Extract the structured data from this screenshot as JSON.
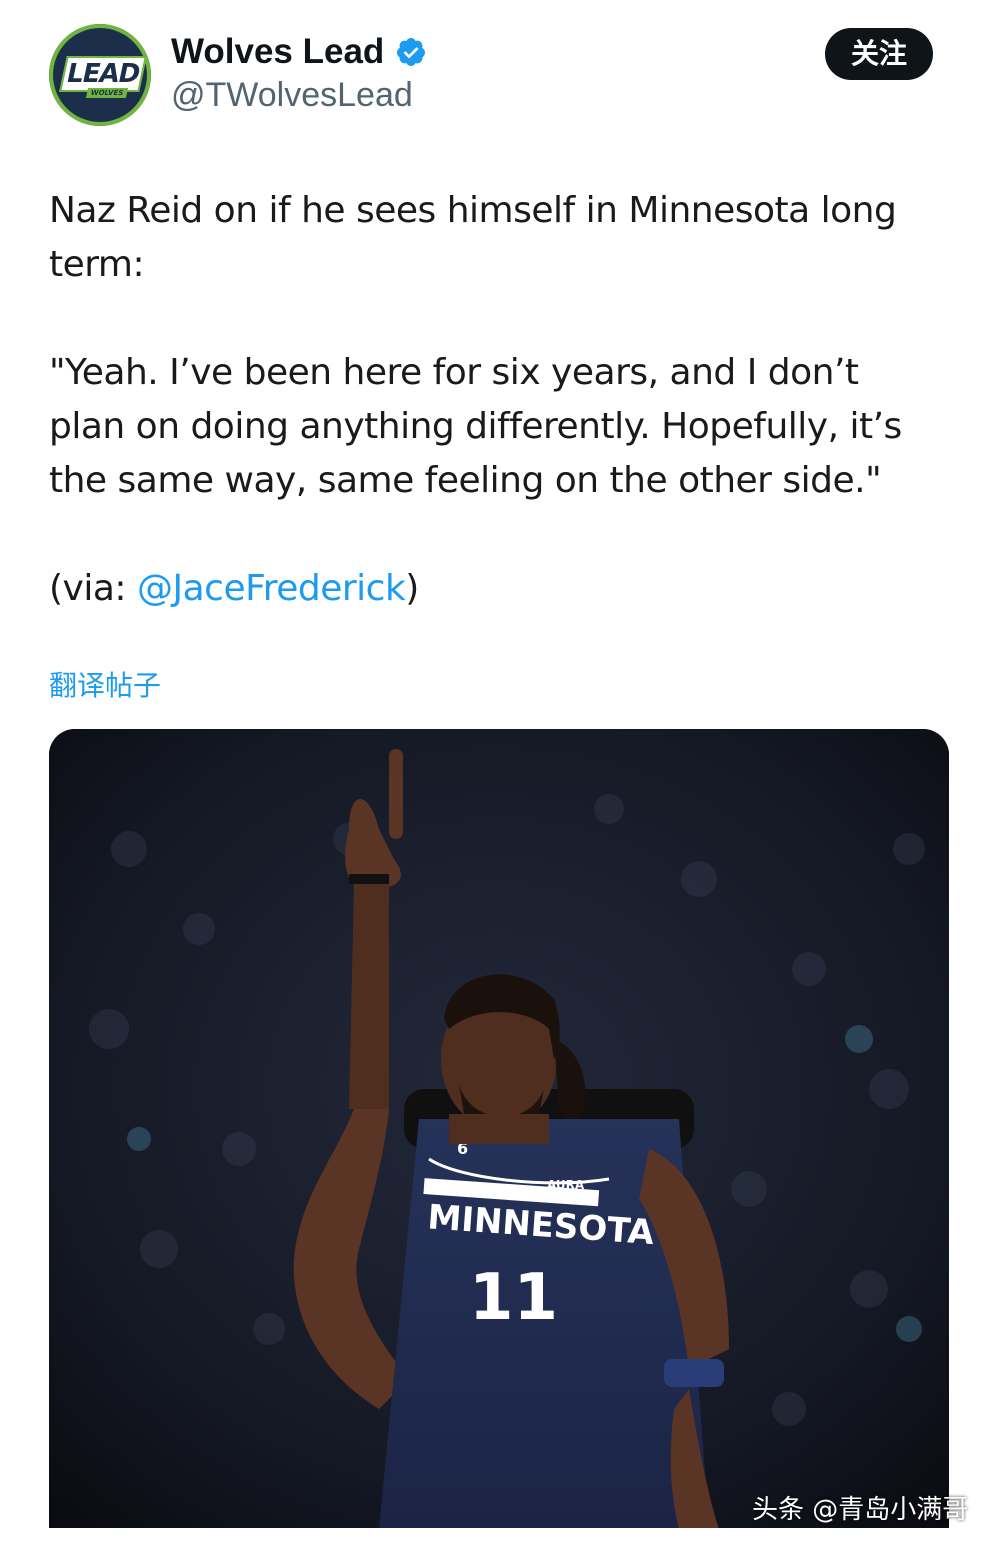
{
  "account": {
    "display_name": "Wolves Lead",
    "handle": "@TWolvesLead",
    "avatar_text": "LEAD",
    "avatar_subtext": "WOLVES",
    "verified_icon": "verified-badge-icon",
    "follow_label": "关注",
    "colors": {
      "avatar_bg": "#1c2f4a",
      "avatar_accent": "#6fb53f",
      "verified": "#1d9bf0"
    }
  },
  "tweet": {
    "paragraph1": "Naz Reid on if he sees himself in Minnesota long term:",
    "paragraph2": "\"Yeah. I’ve been here for six years, and I don’t plan on doing anything differently. Hopefully, it’s the same way, same feeling on the other side.\"",
    "via_prefix": "(via: ",
    "via_mention": "@JaceFrederick",
    "via_suffix": ")",
    "translate_label": "翻译帖子"
  },
  "media": {
    "description_icon": "photo-basketball-player",
    "jersey_team": "MINNESOTA",
    "jersey_number": "11",
    "jersey_patch": "6",
    "jersey_sponsor": "AURA"
  },
  "watermark": "头条 @青岛小满哥",
  "colors": {
    "link": "#1d9bf0",
    "text": "#0f1419",
    "muted": "#536471"
  }
}
